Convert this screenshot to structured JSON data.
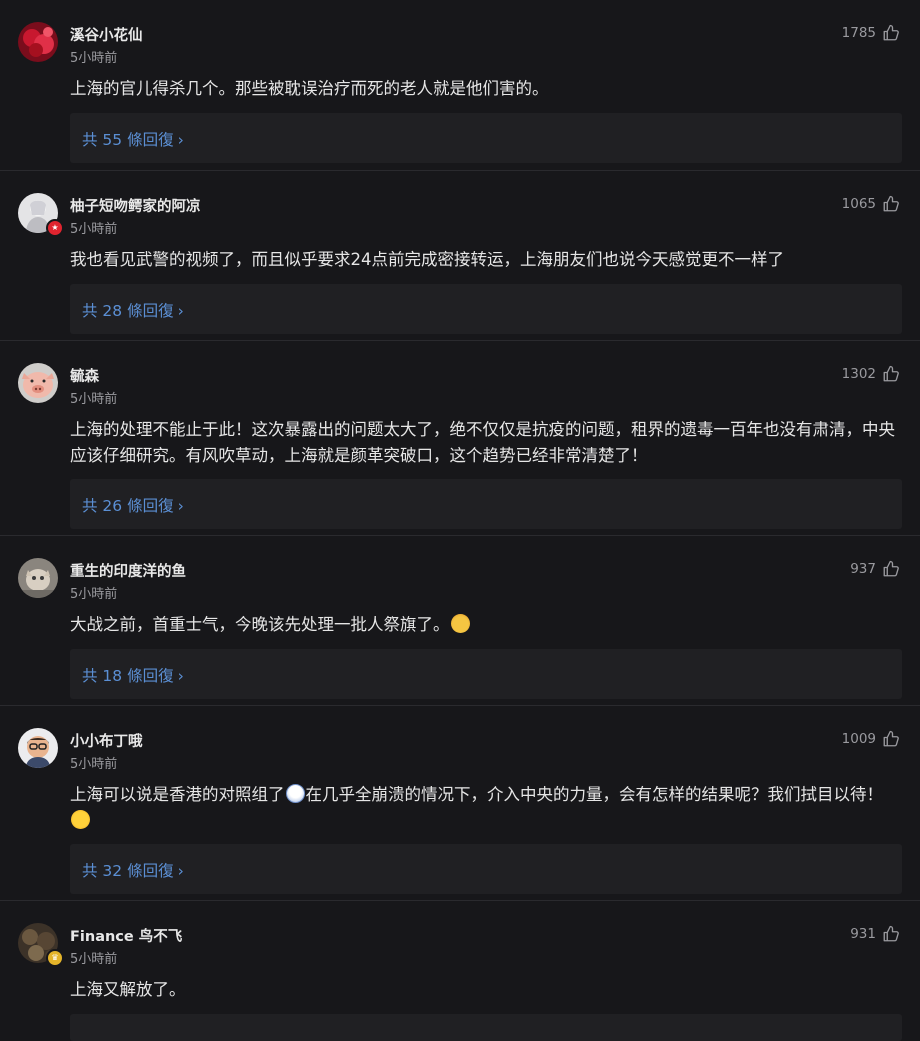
{
  "comments": [
    {
      "username": "溪谷小花仙",
      "time": "5小時前",
      "likes": "1785",
      "text": "上海的官儿得杀几个。那些被耽误治疗而死的老人就是他们害的。",
      "replies": "共 55 條回復",
      "avatar_color": "#b8122a"
    },
    {
      "username": "柚子短吻鳄家的阿凉",
      "time": "5小時前",
      "likes": "1065",
      "text": "我也看见武警的视频了，而且似乎要求24点前完成密接转运，上海朋友们也说今天感觉更不一样了",
      "replies": "共 28 條回復",
      "avatar_color": "#d9d9dc",
      "badge": "★",
      "badge_color": "#e0242f"
    },
    {
      "username": "毓森",
      "time": "5小時前",
      "likes": "1302",
      "text": "上海的处理不能止于此！这次暴露出的问题太大了，绝不仅仅是抗疫的问题，租界的遗毒一百年也没有肃清，中央应该仔细研究。有风吹草动，上海就是颜革突破口，这个趋势已经非常清楚了！",
      "replies": "共 26 條回復",
      "avatar_color": "#e9b7a8"
    },
    {
      "username": "重生的印度洋的鱼",
      "time": "5小時前",
      "likes": "937",
      "text": "大战之前，首重士气，今晚该先处理一批人祭旗了。",
      "replies": "共 18 條回復",
      "avatar_color": "#8d8a85"
    },
    {
      "username": "小小布丁哦",
      "time": "5小時前",
      "likes": "1009",
      "text_parts": [
        "上海可以说是香港的对照组了",
        "在几乎全崩溃的情况下，介入中央的力量，会有怎样的结果呢？我们拭目以待！"
      ],
      "replies": "共 32 條回復",
      "avatar_color": "#e8e8ea"
    },
    {
      "username": "Finance 鸟不飞",
      "time": "5小時前",
      "likes": "931",
      "text": "上海又解放了。",
      "avatar_color": "#5a4b3a",
      "badge": "♛",
      "badge_color": "#e4b42a"
    }
  ],
  "colors": {
    "background": "#17171a",
    "reply_box": "#202023",
    "reply_link": "#5b8fd4",
    "meta_text": "#9a9a9f"
  }
}
